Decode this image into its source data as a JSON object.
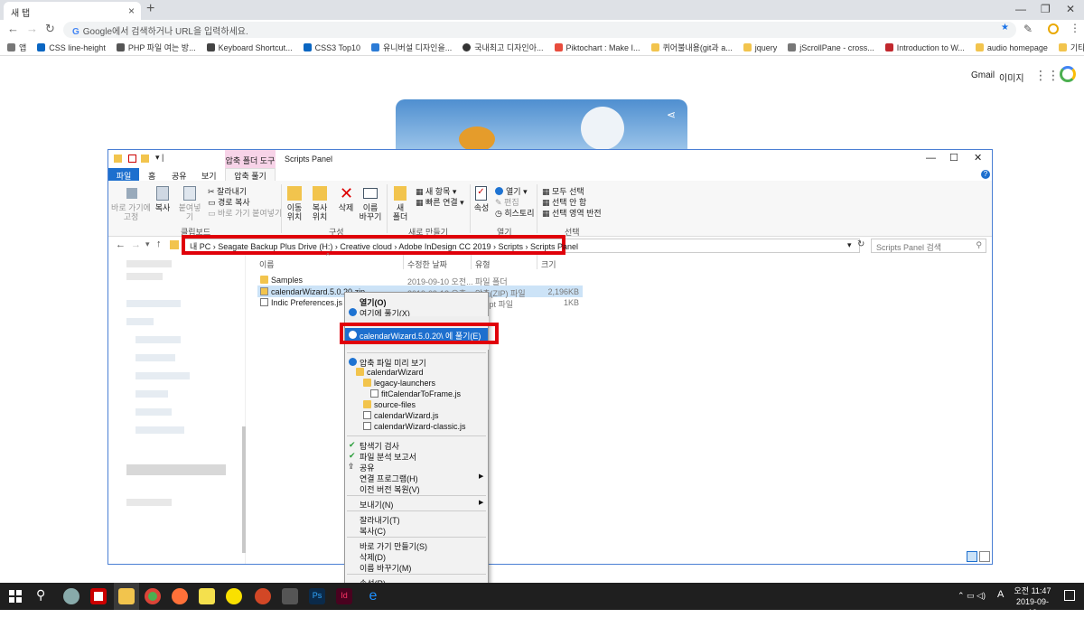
{
  "browser": {
    "tab_title": "새 탭",
    "omnibox_placeholder": "Google에서 검색하거나 URL을 입력하세요.",
    "bookmarks": [
      "앱",
      "CSS line-height",
      "PHP 파일 여는 방...",
      "Keyboard Shortcut...",
      "CSS3 Top10",
      "유니버설 디자인을...",
      "국내최고 디자인아...",
      "Piktochart : Make I...",
      "퀴어불내용(git과 a...",
      "jquery",
      "jScrollPane - cross...",
      "Introduction to W...",
      "audio homepage",
      "기타 북마크"
    ],
    "gmail": "Gmail",
    "images": "이미지"
  },
  "explorer": {
    "contextual_tab": "압축 폴더 도구",
    "window_title": "Scripts Panel",
    "ribbon_tabs": [
      "파일",
      "홈",
      "공유",
      "보기",
      "압축 풀기"
    ],
    "ribbon": {
      "pin": "바로 가기에\n고정",
      "copy": "복사",
      "paste": "붙여넣기",
      "cut": "잘라내기",
      "copy_path": "경로 복사",
      "paste_shortcut": "바로 가기 붙여넣기",
      "group_clipboard": "클립보드",
      "move_to": "이동\n위치",
      "copy_to": "복사\n위치",
      "delete": "삭제",
      "rename": "이름\n바꾸기",
      "group_organize": "구성",
      "new_folder": "새\n폴더",
      "new_item": "새 항목",
      "easy_access": "빠른 연결",
      "group_new": "새로 만들기",
      "properties": "속성",
      "open": "열기",
      "edit": "편집",
      "history": "히스토리",
      "group_open": "열기",
      "select_all": "모두 선택",
      "select_none": "선택 안 함",
      "invert": "선택 영역 반전",
      "group_select": "선택"
    },
    "breadcrumb": [
      "내 PC",
      "Seagate Backup Plus Drive (H:)",
      "Creative cloud",
      "Adobe InDesign CC 2019",
      "Scripts",
      "Scripts Panel"
    ],
    "search_placeholder": "Scripts Panel 검색",
    "columns": [
      "이름",
      "수정한 날짜",
      "유형",
      "크기"
    ],
    "files": [
      {
        "name": "Samples",
        "date": "2019-09-10 오전...",
        "type": "파일 폴더",
        "size": ""
      },
      {
        "name": "calendarWizard.5.0.20.zip",
        "date": "2019-09-12 오후...",
        "type": "압축(ZIP) 파일",
        "size": "2,196KB"
      },
      {
        "name": "Indic Preferences.js",
        "date": "",
        "type": "Script 파일",
        "size": "1KB"
      }
    ]
  },
  "context_menu": {
    "open": "열기(O)",
    "open_here": "여기에 풀기(X)",
    "extract_to": "calendarWizard.5.0.20\\ 에 풀기(E)",
    "preview": "압축 파일 미리 보기",
    "tree": [
      "calendarWizard",
      "legacy-launchers",
      "fitCalendarToFrame.js",
      "source-files",
      "calendarWizard.js",
      "calendarWizard-classic.js"
    ],
    "scan": "탐색기 검사",
    "report": "파일 분석 보고서",
    "share": "공유",
    "open_with": "연결 프로그램(H)",
    "restore": "이전 버전 복원(V)",
    "send_to": "보내기(N)",
    "cut": "잘라내기(T)",
    "copy": "복사(C)",
    "shortcut": "바로 가기 만들기(S)",
    "delete": "삭제(D)",
    "rename": "이름 바꾸기(M)",
    "properties": "속성(R)"
  },
  "taskbar": {
    "time": "오전 11:47",
    "date": "2019-09-13",
    "ime": "A"
  }
}
